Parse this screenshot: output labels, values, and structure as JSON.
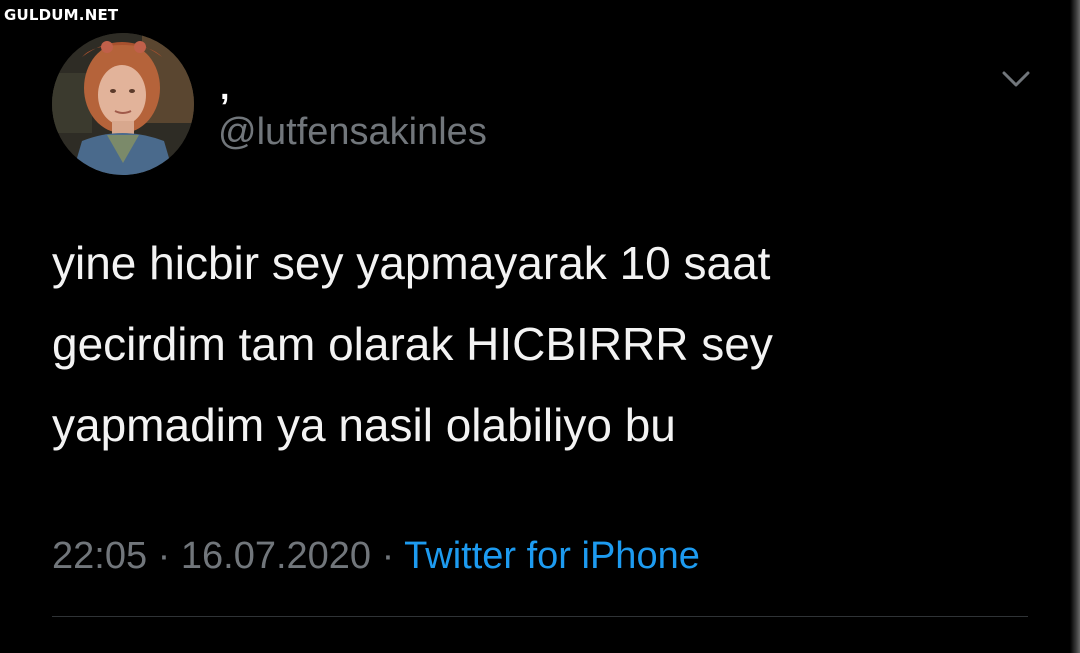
{
  "watermark": "GULDUM.NET",
  "tweet": {
    "display_name": ",",
    "handle": "@lutfensakinles",
    "text_lines": [
      "yine hicbir sey yapmayarak 10 saat",
      "gecirdim tam olarak HICBIRRR sey",
      "yapmadim ya nasil olabiliyo bu"
    ],
    "time": "22:05",
    "separator": "·",
    "date": "16.07.2020",
    "source": "Twitter for iPhone"
  },
  "icons": {
    "more": "chevron-down-icon",
    "avatar": "profile-photo"
  },
  "colors": {
    "background": "#000000",
    "text": "#f3f3f3",
    "secondary": "#71767b",
    "link": "#1d9bf0",
    "divider": "#2f3336"
  }
}
